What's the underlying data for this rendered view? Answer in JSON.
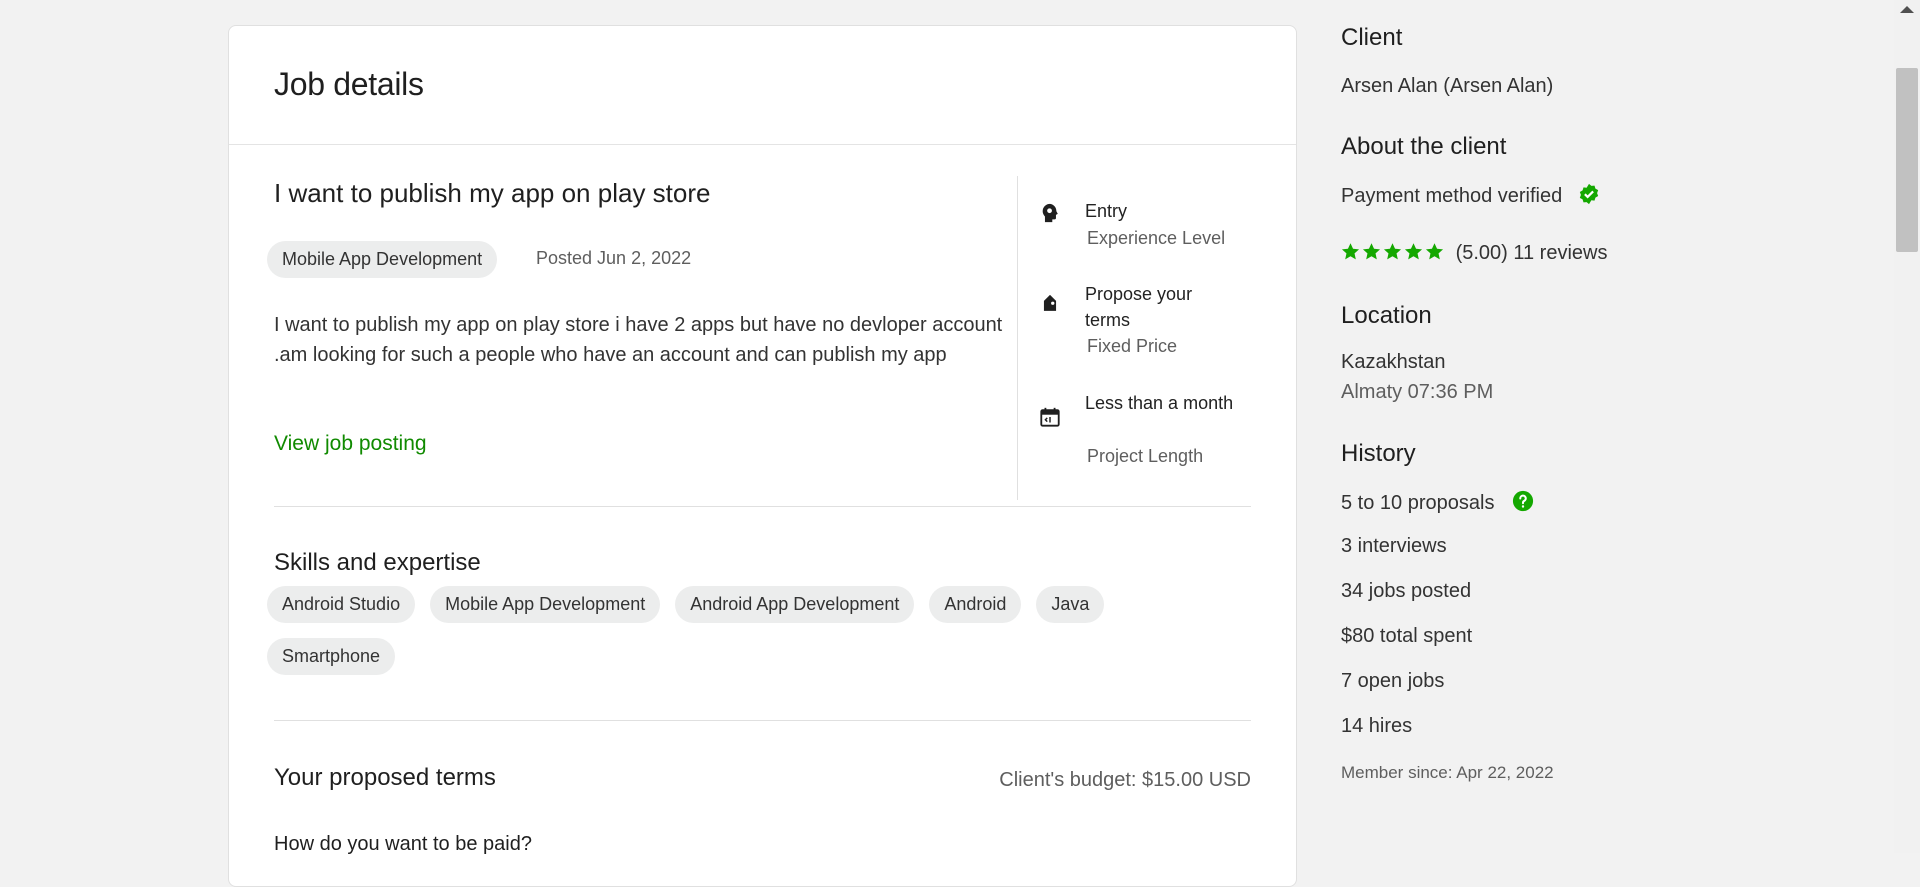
{
  "job": {
    "page_title": "Job details",
    "title": "I want to publish my app on play store",
    "category": "Mobile App Development",
    "posted": "Posted Jun 2, 2022",
    "description": "I want to publish my app on play store i have 2 apps but have no devloper account .am looking for such a people who have an account and can publish my app",
    "view_link": "View job posting",
    "attributes": [
      {
        "main": "Entry",
        "sub": "Experience Level",
        "icon": "brain-icon"
      },
      {
        "main": "Propose your terms",
        "sub": "Fixed Price",
        "icon": "price-tag-icon"
      },
      {
        "main": "Less than a month",
        "sub": "Project Length",
        "icon": "calendar-icon"
      }
    ],
    "skills_title": "Skills and expertise",
    "skills": [
      "Android Studio",
      "Mobile App Development",
      "Android App Development",
      "Android",
      "Java",
      "Smartphone"
    ],
    "terms_title": "Your proposed terms",
    "budget": "Client's budget: $15.00 USD",
    "paid_question": "How do you want to be paid?"
  },
  "client": {
    "heading": "Client",
    "name": "Arsen Alan (Arsen Alan)",
    "about_heading": "About the client",
    "payment": "Payment method verified",
    "rating": "(5.00) 11 reviews",
    "rating_value": 5,
    "location_heading": "Location",
    "country": "Kazakhstan",
    "city_time": "Almaty 07:36 PM",
    "history_heading": "History",
    "proposals": "5 to 10 proposals",
    "interviews": "3 interviews",
    "jobs_posted": "34 jobs posted",
    "total_spent": "$80 total spent",
    "open_jobs": "7 open jobs",
    "hires": "14 hires",
    "member_since": "Member since: Apr 22, 2022"
  },
  "colors": {
    "accent": "#108a00",
    "background": "#f2f2f2"
  }
}
